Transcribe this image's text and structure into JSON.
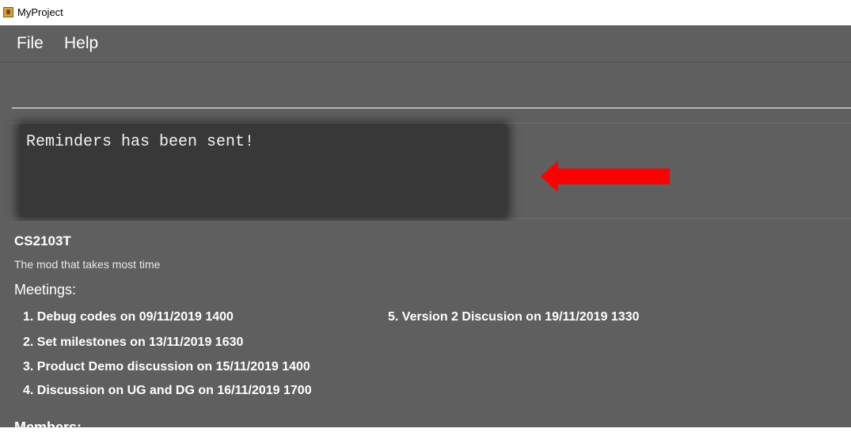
{
  "window": {
    "title": "MyProject"
  },
  "menu": {
    "file": "File",
    "help": "Help"
  },
  "command": {
    "value": "",
    "placeholder": ""
  },
  "result": {
    "text": "Reminders has been sent!"
  },
  "project": {
    "name": "CS2103T",
    "description": "The mod that takes most time",
    "meetings_label": "Meetings:",
    "meetings": [
      "1. Debug codes on 09/11/2019 1400",
      "2. Set milestones on 13/11/2019 1630",
      "3. Product Demo discussion on 15/11/2019 1400",
      "4. Discussion on UG and DG on 16/11/2019 1700",
      "5. Version 2 Discusion on 19/11/2019 1330"
    ],
    "members_label": "Members:"
  },
  "colors": {
    "background": "#5f5f5f",
    "result_box": "#383838",
    "arrow": "#ff0000",
    "text": "#ffffff"
  },
  "icons": {
    "app": "app-icon",
    "annotation": "red-arrow-icon"
  }
}
